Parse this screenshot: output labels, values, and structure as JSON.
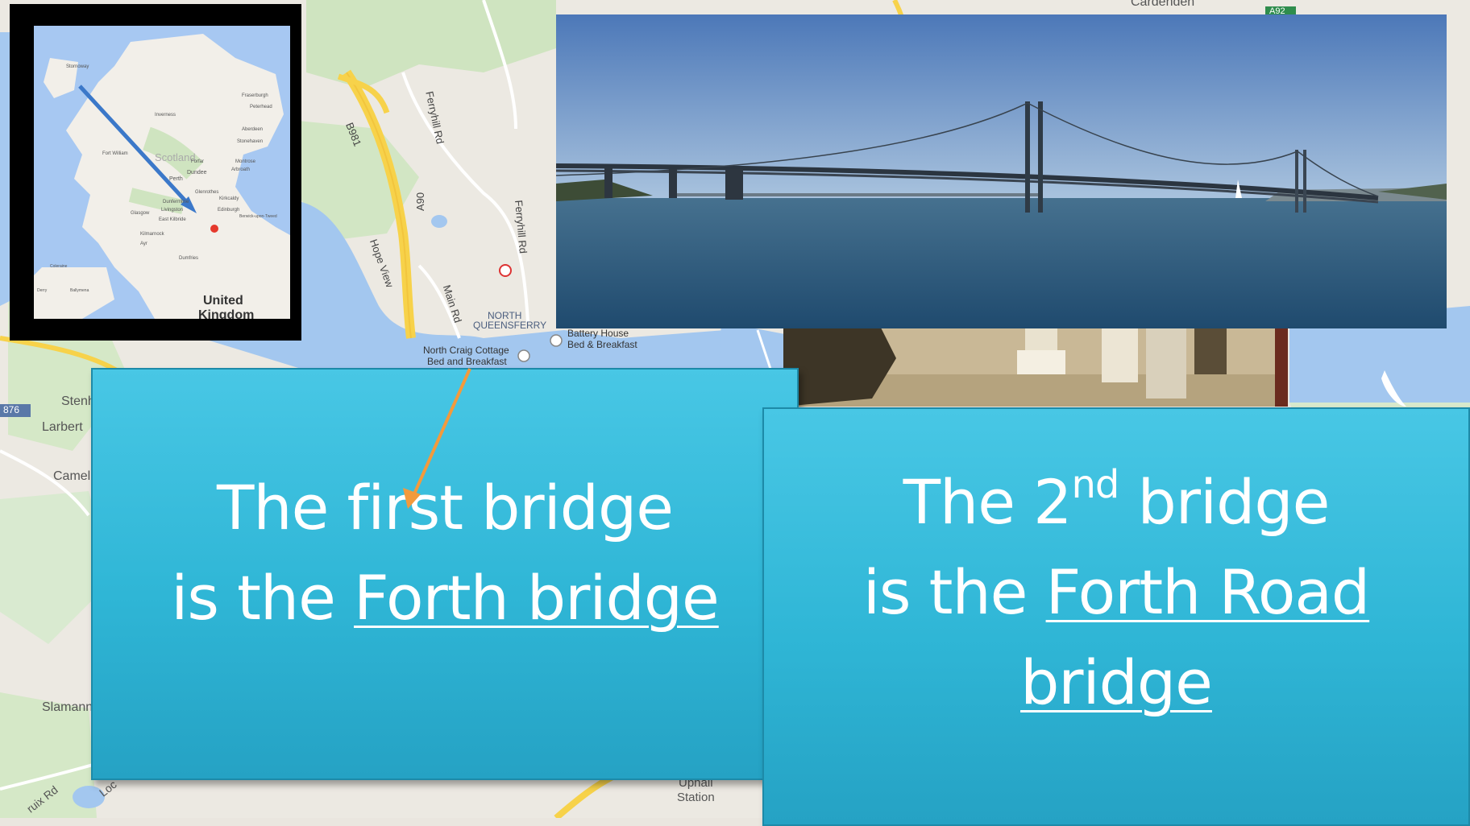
{
  "map": {
    "labels": {
      "b981": "B981",
      "ferryhill_rd_1": "Ferryhill Rd",
      "ferryhill_rd_2": "Ferryhill Rd",
      "a90": "A90",
      "hope_view": "Hope View",
      "main_rd": "Main Rd",
      "north_queensferry_1": "NORTH",
      "north_queensferry_2": "QUEENSFERRY",
      "battery_house_1": "Battery House",
      "battery_house_2": "Bed & Breakfast",
      "north_craig_1": "North Craig Cottage",
      "north_craig_2": "Bed and Breakfast",
      "cardenden": "Cardenden",
      "a92": "A92",
      "stenhouse": "Stenh",
      "larbert": "Larbert",
      "camelon": "Camel",
      "slamannan": "Slamann",
      "b876": "876",
      "uphall_1": "Uphall",
      "uphall_2": "Station",
      "cruix_rd": "ruix Rd",
      "loc": "Loc"
    }
  },
  "inset": {
    "labels": {
      "united": "United",
      "kingdom": "Kingdom",
      "scotland": "Scotland",
      "stornoway": "Stornoway",
      "inverness": "Inverness",
      "aberdeen": "Aberdeen",
      "perth": "Perth",
      "dundee": "Dundee",
      "edinburgh": "Edinburgh",
      "glasgow": "Glasgow",
      "fort_william": "Fort William",
      "fraserburgh": "Fraserburgh",
      "peterhead": "Peterhead",
      "stonehaven": "Stonehaven",
      "montrose": "Montrose",
      "arbroath": "Arbroath",
      "forfar": "Forfar",
      "dunfermline": "Dunfermline",
      "kirkcaldy": "Kirkcaldy",
      "glenrothes": "Glenrothes",
      "livingston": "Livingston",
      "east_kilbride": "East Kilbride",
      "kilmarnock": "Kilmarnock",
      "ayr": "Ayr",
      "dumfries": "Dumfries",
      "berwick": "Berwick-upon-Tweed",
      "coleraine": "Coleraine",
      "ballymena": "Ballymena",
      "derry": "Derry"
    },
    "colors": {
      "arrow": "#3b78c9",
      "sea": "#a7c8f2",
      "land": "#f2efe9",
      "pin": "#e5392c"
    }
  },
  "callouts": {
    "first": {
      "line1": "The first bridge",
      "line2_prefix": "is the ",
      "line2_link": "Forth bridge"
    },
    "second": {
      "line1_prefix": "The 2",
      "line1_sup": "nd",
      "line1_suffix": " bridge",
      "line2_prefix": "is the ",
      "line2_link": "Forth Road",
      "line3_link": "bridge"
    },
    "colors": {
      "box": "#3bbcdc",
      "border": "#1d8aa8",
      "text": "#ffffff",
      "arrow": "#f39a3c"
    }
  }
}
